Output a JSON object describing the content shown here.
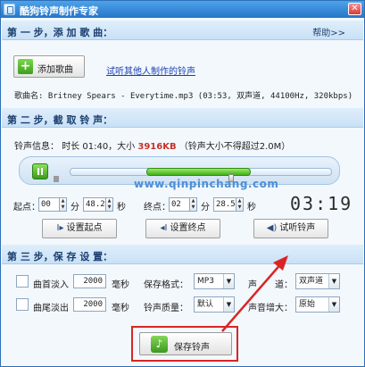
{
  "window": {
    "title": "酷狗铃声制作专家",
    "close_glyph": "✕"
  },
  "step1": {
    "title": "第 一 步，添 加 歌 曲：",
    "help_label": "帮助>>",
    "add_button_label": "添加歌曲",
    "tutorial_link": "试听其他人制作的铃声",
    "song_line": "歌曲名: Britney Spears - Everytime.mp3  (03:53, 双声道, 44100Hz, 320kbps)"
  },
  "step2": {
    "title": "第 二 步，截 取 铃 声：",
    "info_label": "铃声信息：",
    "duration_text": "时长 01:40，大小",
    "size_value": "3916KB",
    "limit_text": "（铃声大小不得超过2.0M）",
    "selection": {
      "start_fraction": 0.29,
      "end_fraction": 0.69
    },
    "watermark": "www.qinpinchang.com",
    "start_label": "起点：",
    "start_min": "00",
    "start_sec": "48.2",
    "end_label": "终点：",
    "end_min": "02",
    "end_sec": "28.5",
    "min_unit": "分",
    "sec_unit": "秒",
    "lcd_time": "03:19",
    "set_start_label": "设置起点",
    "set_end_label": "设置终点",
    "preview_label": "试听铃声"
  },
  "step3": {
    "title": "第 三 步，保 存 设 置：",
    "fade_in_label": "曲首淡入",
    "fade_in_value": "2000",
    "fade_out_label": "曲尾淡出",
    "fade_out_value": "2000",
    "ms_unit": "毫秒",
    "format_label": "保存格式：",
    "format_value": "MP3",
    "quality_label": "铃声质量：",
    "quality_value": "默认",
    "channel_label": "声　　道：",
    "channel_value": "双声道",
    "gain_label": "声音增大：",
    "gain_value": "原始",
    "save_label": "保存铃声"
  },
  "colors": {
    "accent": "#2676c9",
    "selection": "#3fb017",
    "size_value": "#c8322a",
    "highlight": "#d92525"
  }
}
